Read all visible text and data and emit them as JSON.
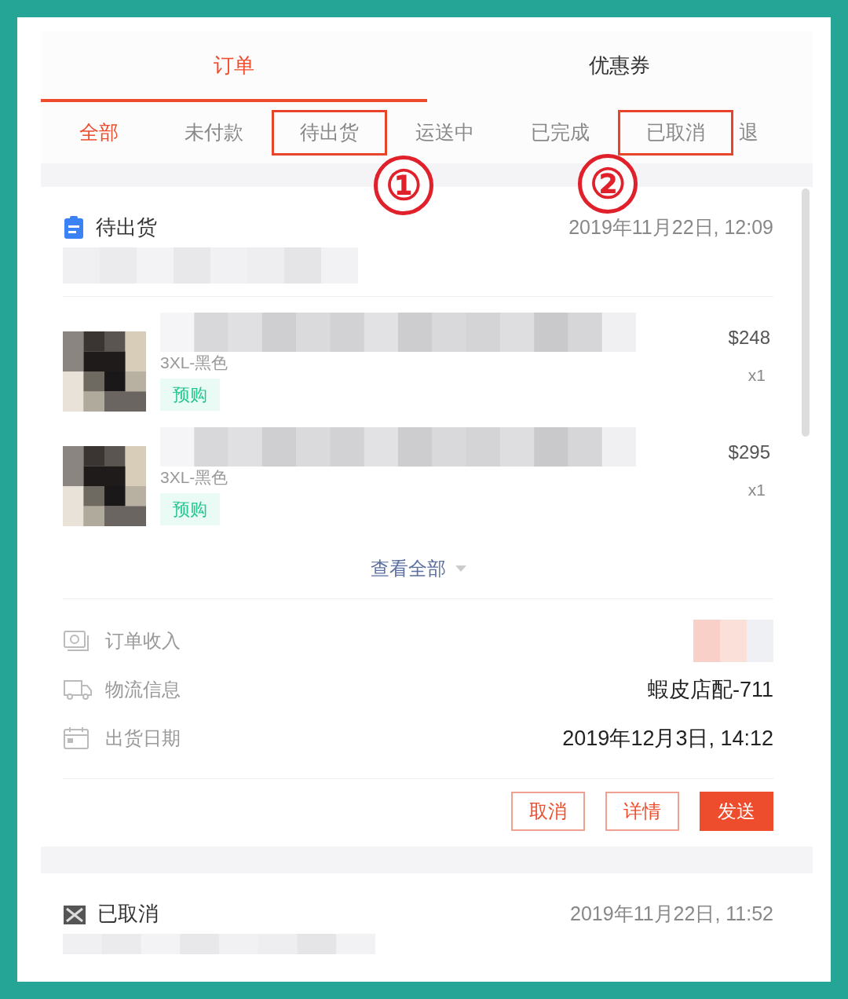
{
  "main_tabs": [
    {
      "label": "订单",
      "selected": true
    },
    {
      "label": "优惠券",
      "selected": false
    }
  ],
  "status_tabs": [
    {
      "label": "全部",
      "selected": true,
      "highlighted": false
    },
    {
      "label": "未付款",
      "selected": false,
      "highlighted": false
    },
    {
      "label": "待出货",
      "selected": false,
      "highlighted": true
    },
    {
      "label": "运送中",
      "selected": false,
      "highlighted": false
    },
    {
      "label": "已完成",
      "selected": false,
      "highlighted": false
    },
    {
      "label": "已取消",
      "selected": false,
      "highlighted": true
    },
    {
      "label": "退",
      "selected": false,
      "highlighted": false
    }
  ],
  "callouts": [
    {
      "label": "①"
    },
    {
      "label": "②"
    }
  ],
  "orders": [
    {
      "kind": "pending",
      "status": "待出货",
      "date": "2019年11月22日, 12:09",
      "items": [
        {
          "variant": "3XL-黑色",
          "tag": "预购",
          "price": "$248",
          "qty": "x1"
        },
        {
          "variant": "3XL-黑色",
          "tag": "预购",
          "price": "$295",
          "qty": "x1"
        }
      ],
      "view_all": "查看全部",
      "info": [
        {
          "kind": "income",
          "label": "订单收入"
        },
        {
          "kind": "shipping",
          "label": "物流信息",
          "value": "蝦皮店配-711"
        },
        {
          "kind": "date",
          "label": "出货日期",
          "value": "2019年12月3日, 14:12"
        }
      ],
      "buttons": [
        {
          "label": "取消",
          "primary": false
        },
        {
          "label": "详情",
          "primary": false
        },
        {
          "label": "发送",
          "primary": true
        }
      ]
    },
    {
      "kind": "cancelled",
      "status": "已取消",
      "date": "2019年11月22日, 11:52"
    }
  ]
}
